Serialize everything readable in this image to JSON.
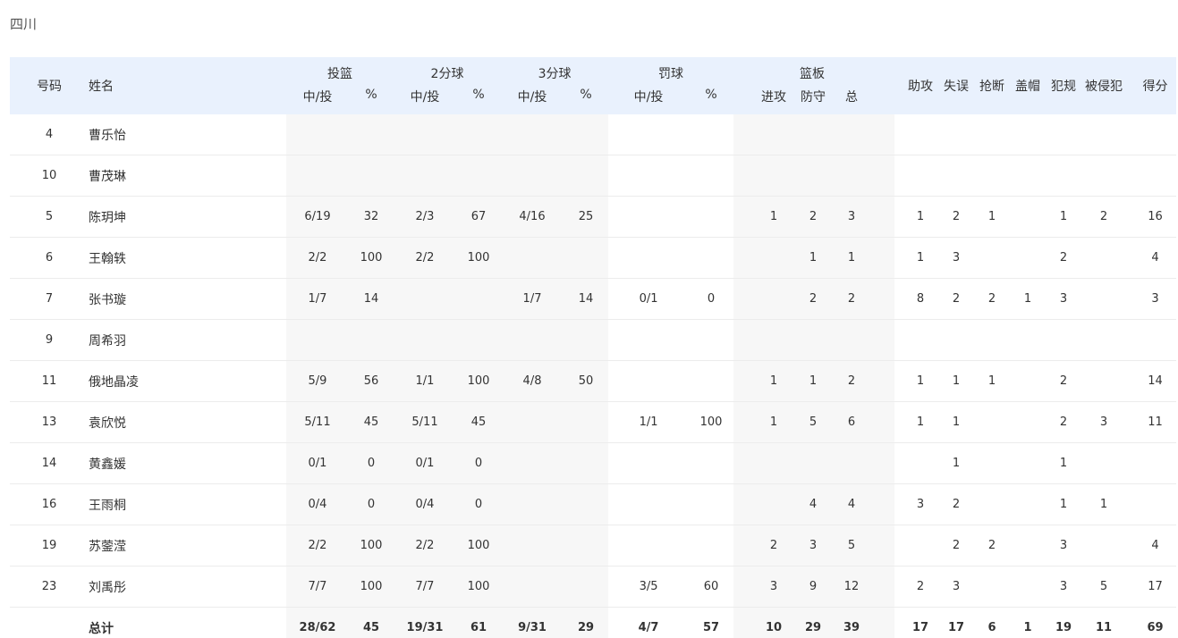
{
  "team": "四川",
  "header": {
    "number": "号码",
    "name": "姓名",
    "groups": {
      "fg": "投篮",
      "two": "2分球",
      "three": "3分球",
      "ft": "罚球",
      "reb": "篮板"
    },
    "made_att": "中/投",
    "pct": "%",
    "off": "进攻",
    "def": "防守",
    "tot": "总",
    "ast": "助攻",
    "to": "失误",
    "stl": "抢断",
    "blk": "盖帽",
    "pf": "犯规",
    "fd": "被侵犯",
    "pts": "得分"
  },
  "rows": [
    {
      "no": "4",
      "name": "曹乐怡",
      "fg": "",
      "fgp": "",
      "two": "",
      "twop": "",
      "three": "",
      "threep": "",
      "ft": "",
      "ftp": "",
      "or": "",
      "dr": "",
      "tr": "",
      "ast": "",
      "to": "",
      "stl": "",
      "blk": "",
      "pf": "",
      "fd": "",
      "pts": ""
    },
    {
      "no": "10",
      "name": "曹茂琳",
      "fg": "",
      "fgp": "",
      "two": "",
      "twop": "",
      "three": "",
      "threep": "",
      "ft": "",
      "ftp": "",
      "or": "",
      "dr": "",
      "tr": "",
      "ast": "",
      "to": "",
      "stl": "",
      "blk": "",
      "pf": "",
      "fd": "",
      "pts": ""
    },
    {
      "no": "5",
      "name": "陈玥坤",
      "fg": "6/19",
      "fgp": "32",
      "two": "2/3",
      "twop": "67",
      "three": "4/16",
      "threep": "25",
      "ft": "",
      "ftp": "",
      "or": "1",
      "dr": "2",
      "tr": "3",
      "ast": "1",
      "to": "2",
      "stl": "1",
      "blk": "",
      "pf": "1",
      "fd": "2",
      "pts": "16"
    },
    {
      "no": "6",
      "name": "王翰轶",
      "fg": "2/2",
      "fgp": "100",
      "two": "2/2",
      "twop": "100",
      "three": "",
      "threep": "",
      "ft": "",
      "ftp": "",
      "or": "",
      "dr": "1",
      "tr": "1",
      "ast": "1",
      "to": "3",
      "stl": "",
      "blk": "",
      "pf": "2",
      "fd": "",
      "pts": "4"
    },
    {
      "no": "7",
      "name": "张书璇",
      "fg": "1/7",
      "fgp": "14",
      "two": "",
      "twop": "",
      "three": "1/7",
      "threep": "14",
      "ft": "0/1",
      "ftp": "0",
      "or": "",
      "dr": "2",
      "tr": "2",
      "ast": "8",
      "to": "2",
      "stl": "2",
      "blk": "1",
      "pf": "3",
      "fd": "",
      "pts": "3"
    },
    {
      "no": "9",
      "name": "周希羽",
      "fg": "",
      "fgp": "",
      "two": "",
      "twop": "",
      "three": "",
      "threep": "",
      "ft": "",
      "ftp": "",
      "or": "",
      "dr": "",
      "tr": "",
      "ast": "",
      "to": "",
      "stl": "",
      "blk": "",
      "pf": "",
      "fd": "",
      "pts": ""
    },
    {
      "no": "11",
      "name": "俄地晶凌",
      "fg": "5/9",
      "fgp": "56",
      "two": "1/1",
      "twop": "100",
      "three": "4/8",
      "threep": "50",
      "ft": "",
      "ftp": "",
      "or": "1",
      "dr": "1",
      "tr": "2",
      "ast": "1",
      "to": "1",
      "stl": "1",
      "blk": "",
      "pf": "2",
      "fd": "",
      "pts": "14"
    },
    {
      "no": "13",
      "name": "袁欣悦",
      "fg": "5/11",
      "fgp": "45",
      "two": "5/11",
      "twop": "45",
      "three": "",
      "threep": "",
      "ft": "1/1",
      "ftp": "100",
      "or": "1",
      "dr": "5",
      "tr": "6",
      "ast": "1",
      "to": "1",
      "stl": "",
      "blk": "",
      "pf": "2",
      "fd": "3",
      "pts": "11"
    },
    {
      "no": "14",
      "name": "黄鑫媛",
      "fg": "0/1",
      "fgp": "0",
      "two": "0/1",
      "twop": "0",
      "three": "",
      "threep": "",
      "ft": "",
      "ftp": "",
      "or": "",
      "dr": "",
      "tr": "",
      "ast": "",
      "to": "1",
      "stl": "",
      "blk": "",
      "pf": "1",
      "fd": "",
      "pts": ""
    },
    {
      "no": "16",
      "name": "王雨桐",
      "fg": "0/4",
      "fgp": "0",
      "two": "0/4",
      "twop": "0",
      "three": "",
      "threep": "",
      "ft": "",
      "ftp": "",
      "or": "",
      "dr": "4",
      "tr": "4",
      "ast": "3",
      "to": "2",
      "stl": "",
      "blk": "",
      "pf": "1",
      "fd": "1",
      "pts": ""
    },
    {
      "no": "19",
      "name": "苏蓥滢",
      "fg": "2/2",
      "fgp": "100",
      "two": "2/2",
      "twop": "100",
      "three": "",
      "threep": "",
      "ft": "",
      "ftp": "",
      "or": "2",
      "dr": "3",
      "tr": "5",
      "ast": "",
      "to": "2",
      "stl": "2",
      "blk": "",
      "pf": "3",
      "fd": "",
      "pts": "4"
    },
    {
      "no": "23",
      "name": "刘禹彤",
      "fg": "7/7",
      "fgp": "100",
      "two": "7/7",
      "twop": "100",
      "three": "",
      "threep": "",
      "ft": "3/5",
      "ftp": "60",
      "or": "3",
      "dr": "9",
      "tr": "12",
      "ast": "2",
      "to": "3",
      "stl": "",
      "blk": "",
      "pf": "3",
      "fd": "5",
      "pts": "17"
    }
  ],
  "total": {
    "no": "",
    "name": "总计",
    "fg": "28/62",
    "fgp": "45",
    "two": "19/31",
    "twop": "61",
    "three": "9/31",
    "threep": "29",
    "ft": "4/7",
    "ftp": "57",
    "or": "10",
    "dr": "29",
    "tr": "39",
    "ast": "17",
    "to": "17",
    "stl": "6",
    "blk": "1",
    "pf": "19",
    "fd": "11",
    "pts": "69"
  }
}
